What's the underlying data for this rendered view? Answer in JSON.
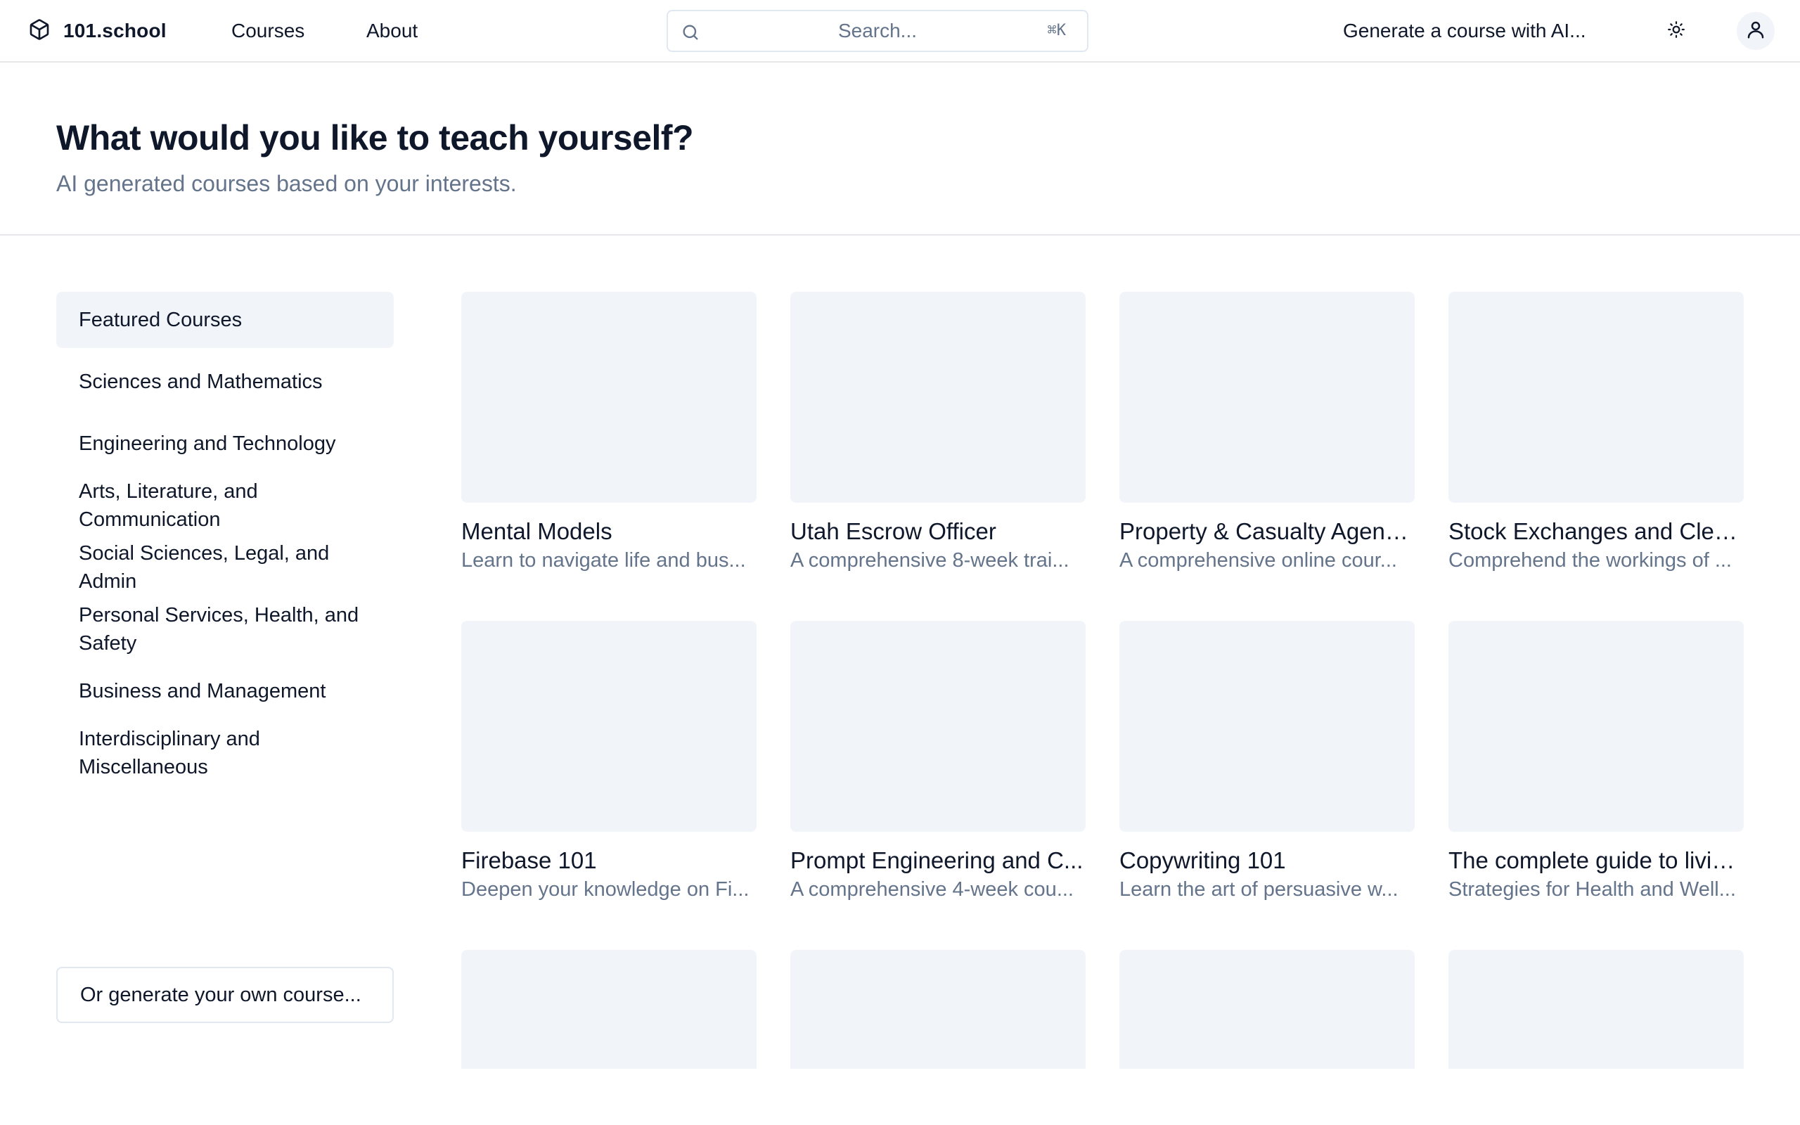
{
  "header": {
    "brand": "101.school",
    "nav": {
      "courses": "Courses",
      "about": "About"
    },
    "search": {
      "placeholder": "Search...",
      "shortcut": "⌘K"
    },
    "generate_ai": "Generate a course with AI...",
    "icons": {
      "brand": "cube-icon",
      "search": "search-icon",
      "theme": "sun-icon",
      "account": "user-icon"
    }
  },
  "hero": {
    "title": "What would you like to teach yourself?",
    "subtitle": "AI generated courses based on your interests."
  },
  "sidebar": {
    "categories": [
      {
        "label": "Featured Courses",
        "active": true
      },
      {
        "label": "Sciences and Mathematics",
        "active": false
      },
      {
        "label": "Engineering and Technology",
        "active": false
      },
      {
        "label": "Arts, Literature, and Communication",
        "active": false
      },
      {
        "label": "Social Sciences, Legal, and Admin",
        "active": false
      },
      {
        "label": "Personal Services, Health, and Safety",
        "active": false
      },
      {
        "label": "Business and Management",
        "active": false
      },
      {
        "label": "Interdisciplinary and Miscellaneous",
        "active": false
      }
    ],
    "generate_own": "Or generate your own course..."
  },
  "courses": [
    {
      "title": "Mental Models",
      "description": "Learn to navigate life and bus..."
    },
    {
      "title": "Utah Escrow Officer",
      "description": "A comprehensive 8-week trai..."
    },
    {
      "title": "Property & Casualty Agent ...",
      "description": "A comprehensive online cour..."
    },
    {
      "title": "Stock Exchanges and Clea...",
      "description": "Comprehend the workings of ..."
    },
    {
      "title": "Firebase 101",
      "description": "Deepen your knowledge on Fi..."
    },
    {
      "title": "Prompt Engineering and C...",
      "description": "A comprehensive 4-week cou..."
    },
    {
      "title": "Copywriting 101",
      "description": "Learn the art of persuasive w..."
    },
    {
      "title": "The complete guide to livin...",
      "description": "Strategies for Health and Well..."
    },
    {
      "title": "",
      "description": ""
    },
    {
      "title": "",
      "description": ""
    },
    {
      "title": "",
      "description": ""
    },
    {
      "title": "",
      "description": ""
    }
  ],
  "colors": {
    "text": "#0f172a",
    "muted": "#64748b",
    "thumb": "#f1f5f9",
    "border": "#e2e8f0"
  }
}
